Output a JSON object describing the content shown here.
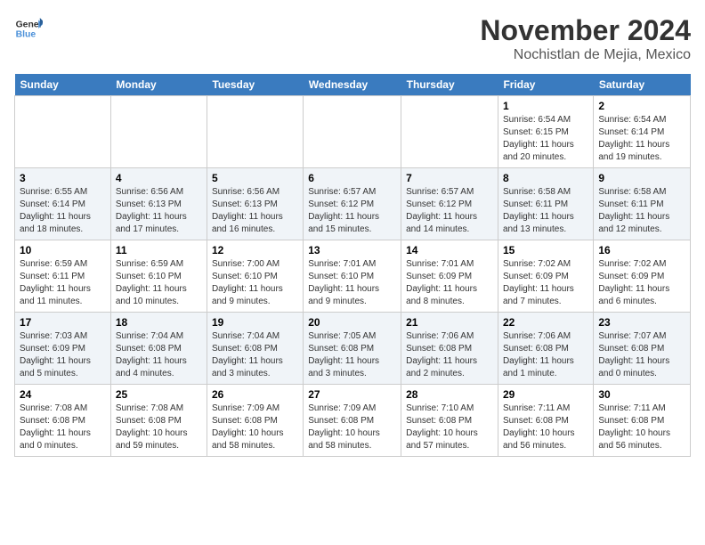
{
  "logo": {
    "line1": "General",
    "line2": "Blue"
  },
  "title": "November 2024",
  "location": "Nochistlan de Mejia, Mexico",
  "days_header": [
    "Sunday",
    "Monday",
    "Tuesday",
    "Wednesday",
    "Thursday",
    "Friday",
    "Saturday"
  ],
  "weeks": [
    [
      {
        "day": "",
        "sunrise": "",
        "sunset": "",
        "daylight": ""
      },
      {
        "day": "",
        "sunrise": "",
        "sunset": "",
        "daylight": ""
      },
      {
        "day": "",
        "sunrise": "",
        "sunset": "",
        "daylight": ""
      },
      {
        "day": "",
        "sunrise": "",
        "sunset": "",
        "daylight": ""
      },
      {
        "day": "",
        "sunrise": "",
        "sunset": "",
        "daylight": ""
      },
      {
        "day": "1",
        "sunrise": "Sunrise: 6:54 AM",
        "sunset": "Sunset: 6:15 PM",
        "daylight": "Daylight: 11 hours and 20 minutes."
      },
      {
        "day": "2",
        "sunrise": "Sunrise: 6:54 AM",
        "sunset": "Sunset: 6:14 PM",
        "daylight": "Daylight: 11 hours and 19 minutes."
      }
    ],
    [
      {
        "day": "3",
        "sunrise": "Sunrise: 6:55 AM",
        "sunset": "Sunset: 6:14 PM",
        "daylight": "Daylight: 11 hours and 18 minutes."
      },
      {
        "day": "4",
        "sunrise": "Sunrise: 6:56 AM",
        "sunset": "Sunset: 6:13 PM",
        "daylight": "Daylight: 11 hours and 17 minutes."
      },
      {
        "day": "5",
        "sunrise": "Sunrise: 6:56 AM",
        "sunset": "Sunset: 6:13 PM",
        "daylight": "Daylight: 11 hours and 16 minutes."
      },
      {
        "day": "6",
        "sunrise": "Sunrise: 6:57 AM",
        "sunset": "Sunset: 6:12 PM",
        "daylight": "Daylight: 11 hours and 15 minutes."
      },
      {
        "day": "7",
        "sunrise": "Sunrise: 6:57 AM",
        "sunset": "Sunset: 6:12 PM",
        "daylight": "Daylight: 11 hours and 14 minutes."
      },
      {
        "day": "8",
        "sunrise": "Sunrise: 6:58 AM",
        "sunset": "Sunset: 6:11 PM",
        "daylight": "Daylight: 11 hours and 13 minutes."
      },
      {
        "day": "9",
        "sunrise": "Sunrise: 6:58 AM",
        "sunset": "Sunset: 6:11 PM",
        "daylight": "Daylight: 11 hours and 12 minutes."
      }
    ],
    [
      {
        "day": "10",
        "sunrise": "Sunrise: 6:59 AM",
        "sunset": "Sunset: 6:11 PM",
        "daylight": "Daylight: 11 hours and 11 minutes."
      },
      {
        "day": "11",
        "sunrise": "Sunrise: 6:59 AM",
        "sunset": "Sunset: 6:10 PM",
        "daylight": "Daylight: 11 hours and 10 minutes."
      },
      {
        "day": "12",
        "sunrise": "Sunrise: 7:00 AM",
        "sunset": "Sunset: 6:10 PM",
        "daylight": "Daylight: 11 hours and 9 minutes."
      },
      {
        "day": "13",
        "sunrise": "Sunrise: 7:01 AM",
        "sunset": "Sunset: 6:10 PM",
        "daylight": "Daylight: 11 hours and 9 minutes."
      },
      {
        "day": "14",
        "sunrise": "Sunrise: 7:01 AM",
        "sunset": "Sunset: 6:09 PM",
        "daylight": "Daylight: 11 hours and 8 minutes."
      },
      {
        "day": "15",
        "sunrise": "Sunrise: 7:02 AM",
        "sunset": "Sunset: 6:09 PM",
        "daylight": "Daylight: 11 hours and 7 minutes."
      },
      {
        "day": "16",
        "sunrise": "Sunrise: 7:02 AM",
        "sunset": "Sunset: 6:09 PM",
        "daylight": "Daylight: 11 hours and 6 minutes."
      }
    ],
    [
      {
        "day": "17",
        "sunrise": "Sunrise: 7:03 AM",
        "sunset": "Sunset: 6:09 PM",
        "daylight": "Daylight: 11 hours and 5 minutes."
      },
      {
        "day": "18",
        "sunrise": "Sunrise: 7:04 AM",
        "sunset": "Sunset: 6:08 PM",
        "daylight": "Daylight: 11 hours and 4 minutes."
      },
      {
        "day": "19",
        "sunrise": "Sunrise: 7:04 AM",
        "sunset": "Sunset: 6:08 PM",
        "daylight": "Daylight: 11 hours and 3 minutes."
      },
      {
        "day": "20",
        "sunrise": "Sunrise: 7:05 AM",
        "sunset": "Sunset: 6:08 PM",
        "daylight": "Daylight: 11 hours and 3 minutes."
      },
      {
        "day": "21",
        "sunrise": "Sunrise: 7:06 AM",
        "sunset": "Sunset: 6:08 PM",
        "daylight": "Daylight: 11 hours and 2 minutes."
      },
      {
        "day": "22",
        "sunrise": "Sunrise: 7:06 AM",
        "sunset": "Sunset: 6:08 PM",
        "daylight": "Daylight: 11 hours and 1 minute."
      },
      {
        "day": "23",
        "sunrise": "Sunrise: 7:07 AM",
        "sunset": "Sunset: 6:08 PM",
        "daylight": "Daylight: 11 hours and 0 minutes."
      }
    ],
    [
      {
        "day": "24",
        "sunrise": "Sunrise: 7:08 AM",
        "sunset": "Sunset: 6:08 PM",
        "daylight": "Daylight: 11 hours and 0 minutes."
      },
      {
        "day": "25",
        "sunrise": "Sunrise: 7:08 AM",
        "sunset": "Sunset: 6:08 PM",
        "daylight": "Daylight: 10 hours and 59 minutes."
      },
      {
        "day": "26",
        "sunrise": "Sunrise: 7:09 AM",
        "sunset": "Sunset: 6:08 PM",
        "daylight": "Daylight: 10 hours and 58 minutes."
      },
      {
        "day": "27",
        "sunrise": "Sunrise: 7:09 AM",
        "sunset": "Sunset: 6:08 PM",
        "daylight": "Daylight: 10 hours and 58 minutes."
      },
      {
        "day": "28",
        "sunrise": "Sunrise: 7:10 AM",
        "sunset": "Sunset: 6:08 PM",
        "daylight": "Daylight: 10 hours and 57 minutes."
      },
      {
        "day": "29",
        "sunrise": "Sunrise: 7:11 AM",
        "sunset": "Sunset: 6:08 PM",
        "daylight": "Daylight: 10 hours and 56 minutes."
      },
      {
        "day": "30",
        "sunrise": "Sunrise: 7:11 AM",
        "sunset": "Sunset: 6:08 PM",
        "daylight": "Daylight: 10 hours and 56 minutes."
      }
    ]
  ]
}
